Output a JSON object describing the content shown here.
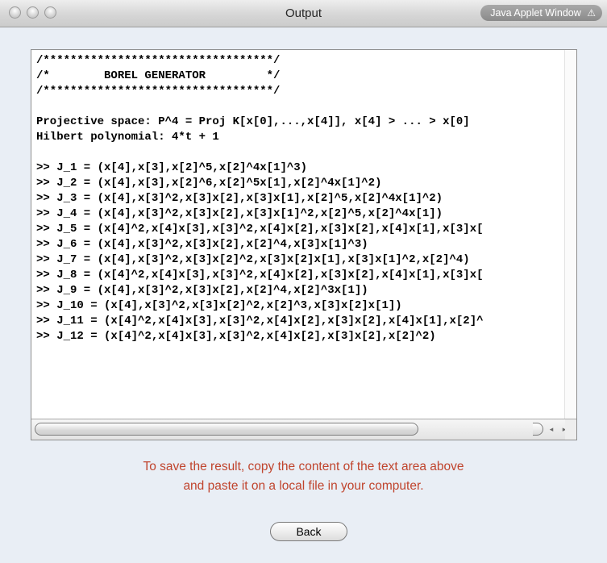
{
  "window": {
    "title": "Output",
    "applet_badge": "Java Applet Window",
    "warning_icon": "⚠"
  },
  "output": {
    "lines": [
      "/**********************************/",
      "/*        BOREL GENERATOR         */",
      "/**********************************/",
      "",
      "Projective space: P^4 = Proj K[x[0],...,x[4]], x[4] > ... > x[0]",
      "Hilbert polynomial: 4*t + 1",
      "",
      ">> J_1 = (x[4],x[3],x[2]^5,x[2]^4x[1]^3)",
      ">> J_2 = (x[4],x[3],x[2]^6,x[2]^5x[1],x[2]^4x[1]^2)",
      ">> J_3 = (x[4],x[3]^2,x[3]x[2],x[3]x[1],x[2]^5,x[2]^4x[1]^2)",
      ">> J_4 = (x[4],x[3]^2,x[3]x[2],x[3]x[1]^2,x[2]^5,x[2]^4x[1])",
      ">> J_5 = (x[4]^2,x[4]x[3],x[3]^2,x[4]x[2],x[3]x[2],x[4]x[1],x[3]x[",
      ">> J_6 = (x[4],x[3]^2,x[3]x[2],x[2]^4,x[3]x[1]^3)",
      ">> J_7 = (x[4],x[3]^2,x[3]x[2]^2,x[3]x[2]x[1],x[3]x[1]^2,x[2]^4)",
      ">> J_8 = (x[4]^2,x[4]x[3],x[3]^2,x[4]x[2],x[3]x[2],x[4]x[1],x[3]x[",
      ">> J_9 = (x[4],x[3]^2,x[3]x[2],x[2]^4,x[2]^3x[1])",
      ">> J_10 = (x[4],x[3]^2,x[3]x[2]^2,x[2]^3,x[3]x[2]x[1])",
      ">> J_11 = (x[4]^2,x[4]x[3],x[3]^2,x[4]x[2],x[3]x[2],x[4]x[1],x[2]^",
      ">> J_12 = (x[4]^2,x[4]x[3],x[3]^2,x[4]x[2],x[3]x[2],x[2]^2)"
    ]
  },
  "message": {
    "line1": "To save the result, copy the content of the text area above",
    "line2": "and paste it on a local file in your computer."
  },
  "back_button": {
    "label": "Back"
  },
  "scroll": {
    "left_arrow": "◂",
    "right_arrow": "▸"
  },
  "colors": {
    "window_bg": "#e9eef5",
    "message_text": "#c0442d"
  }
}
